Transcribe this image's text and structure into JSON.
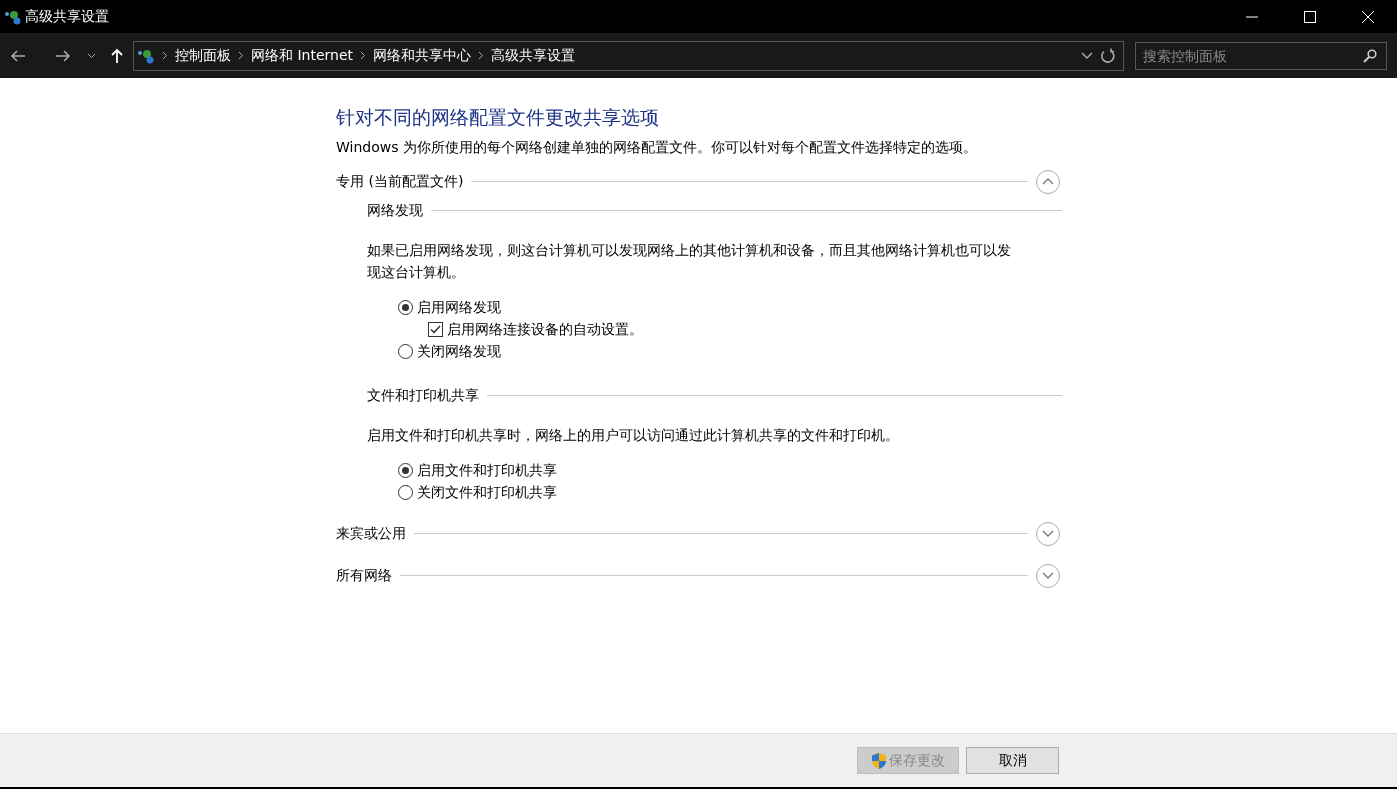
{
  "window": {
    "title": "高级共享设置"
  },
  "address_bar": {
    "breadcrumbs": [
      "控制面板",
      "网络和 Internet",
      "网络和共享中心",
      "高级共享设置"
    ]
  },
  "search": {
    "placeholder": "搜索控制面板"
  },
  "heading": "针对不同的网络配置文件更改共享选项",
  "intro": "Windows 为你所使用的每个网络创建单独的网络配置文件。你可以针对每个配置文件选择特定的选项。",
  "profiles": [
    {
      "title": "专用 (当前配置文件)",
      "expanded": true,
      "sections": [
        {
          "title": "网络发现",
          "description": "如果已启用网络发现，则这台计算机可以发现网络上的其他计算机和设备，而且其他网络计算机也可以发现这台计算机。",
          "options": [
            {
              "kind": "radio",
              "label": "启用网络发现",
              "selected": true,
              "children": [
                {
                  "kind": "checkbox",
                  "label": "启用网络连接设备的自动设置。",
                  "checked": true
                }
              ]
            },
            {
              "kind": "radio",
              "label": "关闭网络发现",
              "selected": false
            }
          ]
        },
        {
          "title": "文件和打印机共享",
          "description": "启用文件和打印机共享时，网络上的用户可以访问通过此计算机共享的文件和打印机。",
          "options": [
            {
              "kind": "radio",
              "label": "启用文件和打印机共享",
              "selected": true
            },
            {
              "kind": "radio",
              "label": "关闭文件和打印机共享",
              "selected": false
            }
          ]
        }
      ]
    },
    {
      "title": "来宾或公用",
      "expanded": false
    },
    {
      "title": "所有网络",
      "expanded": false
    }
  ],
  "buttons": [
    {
      "label": "保存更改",
      "disabled": true,
      "shield": true
    },
    {
      "label": "取消",
      "disabled": false,
      "shield": false
    }
  ]
}
